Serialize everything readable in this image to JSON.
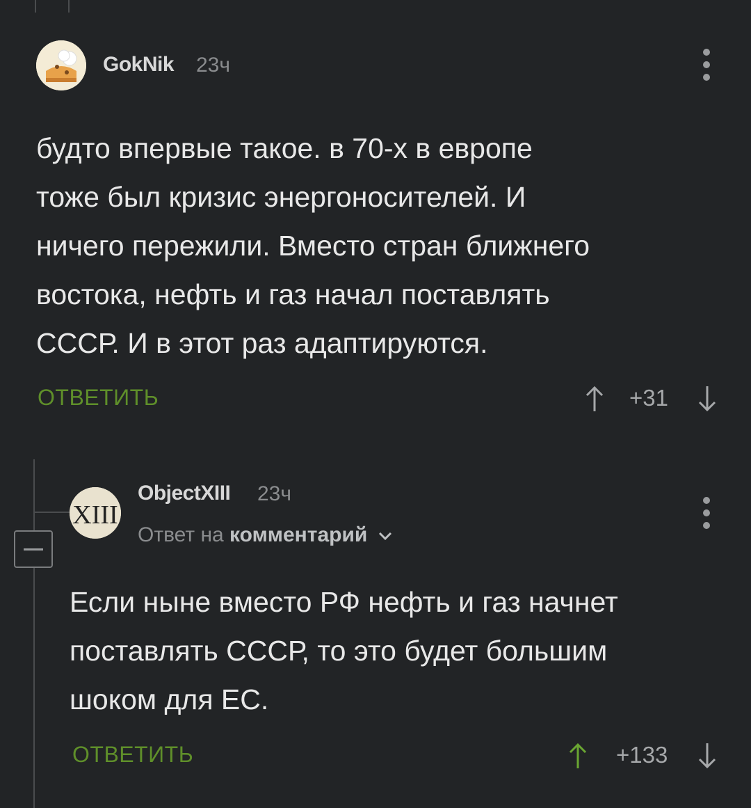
{
  "comments": [
    {
      "username": "GokNik",
      "time": "23ч",
      "text": "будто впервые такое. в 70-х в европе\nтоже был кризис энергоносителей. И\nничего пережили. Вместо стран ближнего\nвостока, нефть и газ начал поставлять\nСССР.  И в этот раз адаптируются.",
      "reply_label": "ОТВЕТИТЬ",
      "score": "+31"
    },
    {
      "username": "ObjectXIII",
      "time": "23ч",
      "avatar_text": "XIII",
      "reply_to_prefix": "Ответ на",
      "reply_to_link": "комментарий",
      "text": "Если ныне вместо РФ нефть и газ начнет\nпоставлять СССР, то это будет большим\nшоком для ЕС.",
      "reply_label": "ОТВЕТИТЬ",
      "score": "+133"
    }
  ],
  "colors": {
    "background": "#222426",
    "reply_green": "#5f8f2a",
    "upvoted_green": "#6aa632",
    "muted": "#8a8c8e"
  }
}
